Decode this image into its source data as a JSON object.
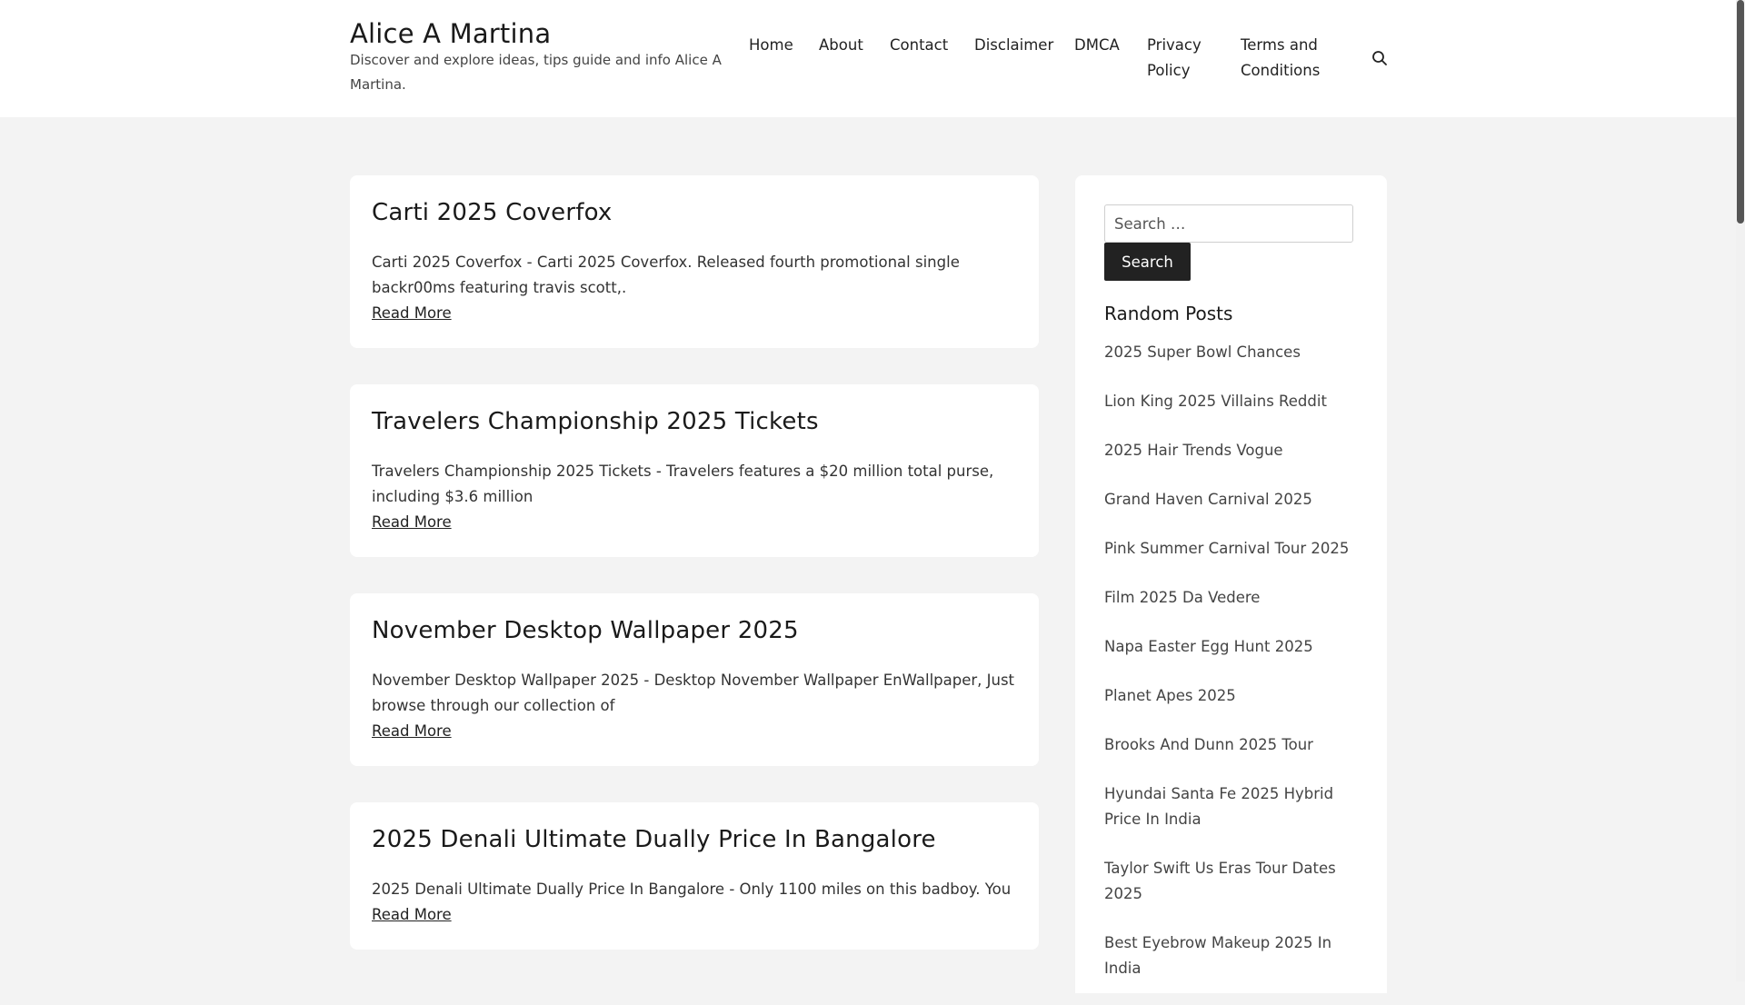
{
  "site": {
    "title": "Alice A Martina",
    "tagline": "Discover and explore ideas, tips guide and info Alice A Martina."
  },
  "nav": {
    "items": [
      "Home",
      "About",
      "Contact",
      "Disclaimer",
      "DMCA",
      "Privacy Policy",
      "Terms and Conditions"
    ]
  },
  "icons": {
    "search": "search-icon"
  },
  "posts": [
    {
      "title": "Carti 2025 Coverfox",
      "excerpt": "Carti 2025 Coverfox - Carti 2025 Coverfox. Released fourth promotional single backr00ms featuring travis scott,.",
      "read_more": "Read More"
    },
    {
      "title": "Travelers Championship 2025 Tickets",
      "excerpt": "Travelers Championship 2025 Tickets - Travelers features a $20 million total purse, including $3.6 million",
      "read_more": "Read More"
    },
    {
      "title": "November Desktop Wallpaper 2025",
      "excerpt": "November Desktop Wallpaper 2025 - Desktop November Wallpaper EnWallpaper, Just browse through our collection of",
      "read_more": "Read More"
    },
    {
      "title": "2025 Denali Ultimate Dually Price In Bangalore",
      "excerpt": "2025 Denali Ultimate Dually Price In Bangalore - Only 1100 miles on this badboy. You",
      "read_more": "Read More"
    }
  ],
  "sidebar": {
    "search_placeholder": "Search …",
    "search_button": "Search",
    "widget_title": "Random Posts",
    "random_posts": [
      "2025 Super Bowl Chances",
      "Lion King 2025 Villains Reddit",
      "2025 Hair Trends Vogue",
      "Grand Haven Carnival 2025",
      "Pink Summer Carnival Tour 2025",
      "Film 2025 Da Vedere",
      "Napa Easter Egg Hunt 2025",
      "Planet Apes 2025",
      "Brooks And Dunn 2025 Tour",
      "Hyundai Santa Fe 2025 Hybrid Price In India",
      "Taylor Swift Us Eras Tour Dates 2025",
      "Best Eyebrow Makeup 2025 In India"
    ]
  }
}
